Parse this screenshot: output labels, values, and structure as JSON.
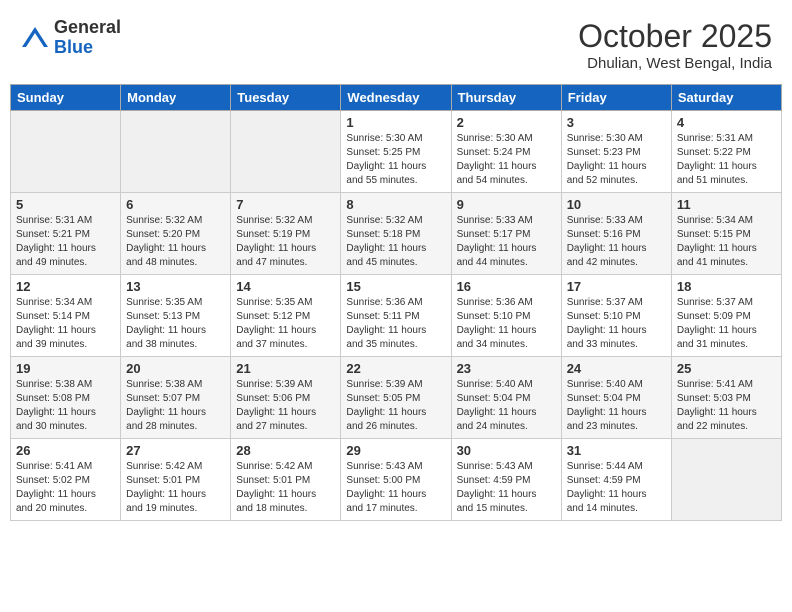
{
  "logo": {
    "general": "General",
    "blue": "Blue"
  },
  "title": {
    "month": "October 2025",
    "location": "Dhulian, West Bengal, India"
  },
  "days_of_week": [
    "Sunday",
    "Monday",
    "Tuesday",
    "Wednesday",
    "Thursday",
    "Friday",
    "Saturday"
  ],
  "weeks": [
    [
      {
        "day": "",
        "info": ""
      },
      {
        "day": "",
        "info": ""
      },
      {
        "day": "",
        "info": ""
      },
      {
        "day": "1",
        "info": "Sunrise: 5:30 AM\nSunset: 5:25 PM\nDaylight: 11 hours\nand 55 minutes."
      },
      {
        "day": "2",
        "info": "Sunrise: 5:30 AM\nSunset: 5:24 PM\nDaylight: 11 hours\nand 54 minutes."
      },
      {
        "day": "3",
        "info": "Sunrise: 5:30 AM\nSunset: 5:23 PM\nDaylight: 11 hours\nand 52 minutes."
      },
      {
        "day": "4",
        "info": "Sunrise: 5:31 AM\nSunset: 5:22 PM\nDaylight: 11 hours\nand 51 minutes."
      }
    ],
    [
      {
        "day": "5",
        "info": "Sunrise: 5:31 AM\nSunset: 5:21 PM\nDaylight: 11 hours\nand 49 minutes."
      },
      {
        "day": "6",
        "info": "Sunrise: 5:32 AM\nSunset: 5:20 PM\nDaylight: 11 hours\nand 48 minutes."
      },
      {
        "day": "7",
        "info": "Sunrise: 5:32 AM\nSunset: 5:19 PM\nDaylight: 11 hours\nand 47 minutes."
      },
      {
        "day": "8",
        "info": "Sunrise: 5:32 AM\nSunset: 5:18 PM\nDaylight: 11 hours\nand 45 minutes."
      },
      {
        "day": "9",
        "info": "Sunrise: 5:33 AM\nSunset: 5:17 PM\nDaylight: 11 hours\nand 44 minutes."
      },
      {
        "day": "10",
        "info": "Sunrise: 5:33 AM\nSunset: 5:16 PM\nDaylight: 11 hours\nand 42 minutes."
      },
      {
        "day": "11",
        "info": "Sunrise: 5:34 AM\nSunset: 5:15 PM\nDaylight: 11 hours\nand 41 minutes."
      }
    ],
    [
      {
        "day": "12",
        "info": "Sunrise: 5:34 AM\nSunset: 5:14 PM\nDaylight: 11 hours\nand 39 minutes."
      },
      {
        "day": "13",
        "info": "Sunrise: 5:35 AM\nSunset: 5:13 PM\nDaylight: 11 hours\nand 38 minutes."
      },
      {
        "day": "14",
        "info": "Sunrise: 5:35 AM\nSunset: 5:12 PM\nDaylight: 11 hours\nand 37 minutes."
      },
      {
        "day": "15",
        "info": "Sunrise: 5:36 AM\nSunset: 5:11 PM\nDaylight: 11 hours\nand 35 minutes."
      },
      {
        "day": "16",
        "info": "Sunrise: 5:36 AM\nSunset: 5:10 PM\nDaylight: 11 hours\nand 34 minutes."
      },
      {
        "day": "17",
        "info": "Sunrise: 5:37 AM\nSunset: 5:10 PM\nDaylight: 11 hours\nand 33 minutes."
      },
      {
        "day": "18",
        "info": "Sunrise: 5:37 AM\nSunset: 5:09 PM\nDaylight: 11 hours\nand 31 minutes."
      }
    ],
    [
      {
        "day": "19",
        "info": "Sunrise: 5:38 AM\nSunset: 5:08 PM\nDaylight: 11 hours\nand 30 minutes."
      },
      {
        "day": "20",
        "info": "Sunrise: 5:38 AM\nSunset: 5:07 PM\nDaylight: 11 hours\nand 28 minutes."
      },
      {
        "day": "21",
        "info": "Sunrise: 5:39 AM\nSunset: 5:06 PM\nDaylight: 11 hours\nand 27 minutes."
      },
      {
        "day": "22",
        "info": "Sunrise: 5:39 AM\nSunset: 5:05 PM\nDaylight: 11 hours\nand 26 minutes."
      },
      {
        "day": "23",
        "info": "Sunrise: 5:40 AM\nSunset: 5:04 PM\nDaylight: 11 hours\nand 24 minutes."
      },
      {
        "day": "24",
        "info": "Sunrise: 5:40 AM\nSunset: 5:04 PM\nDaylight: 11 hours\nand 23 minutes."
      },
      {
        "day": "25",
        "info": "Sunrise: 5:41 AM\nSunset: 5:03 PM\nDaylight: 11 hours\nand 22 minutes."
      }
    ],
    [
      {
        "day": "26",
        "info": "Sunrise: 5:41 AM\nSunset: 5:02 PM\nDaylight: 11 hours\nand 20 minutes."
      },
      {
        "day": "27",
        "info": "Sunrise: 5:42 AM\nSunset: 5:01 PM\nDaylight: 11 hours\nand 19 minutes."
      },
      {
        "day": "28",
        "info": "Sunrise: 5:42 AM\nSunset: 5:01 PM\nDaylight: 11 hours\nand 18 minutes."
      },
      {
        "day": "29",
        "info": "Sunrise: 5:43 AM\nSunset: 5:00 PM\nDaylight: 11 hours\nand 17 minutes."
      },
      {
        "day": "30",
        "info": "Sunrise: 5:43 AM\nSunset: 4:59 PM\nDaylight: 11 hours\nand 15 minutes."
      },
      {
        "day": "31",
        "info": "Sunrise: 5:44 AM\nSunset: 4:59 PM\nDaylight: 11 hours\nand 14 minutes."
      },
      {
        "day": "",
        "info": ""
      }
    ]
  ]
}
